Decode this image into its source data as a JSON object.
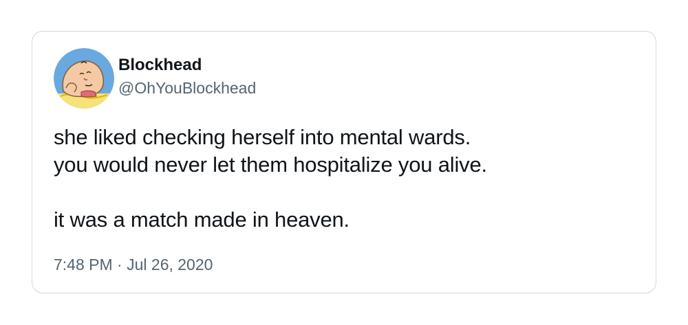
{
  "tweet": {
    "author": {
      "display_name": "Blockhead",
      "handle": "@OhYouBlockhead",
      "avatar_icon": "charlie-brown-avatar-icon"
    },
    "lines": [
      "she liked checking herself into mental wards.",
      "you would never let them hospitalize you alive.",
      "",
      "it was a match made in heaven."
    ],
    "time": "7:48 PM",
    "separator": "·",
    "date": "Jul 26, 2020"
  },
  "colors": {
    "card_border": "#cfd9de",
    "text_primary": "#0f1419",
    "text_secondary": "#536471",
    "avatar_background": "#6aa8e0",
    "avatar_skin": "#f4c9a4"
  }
}
